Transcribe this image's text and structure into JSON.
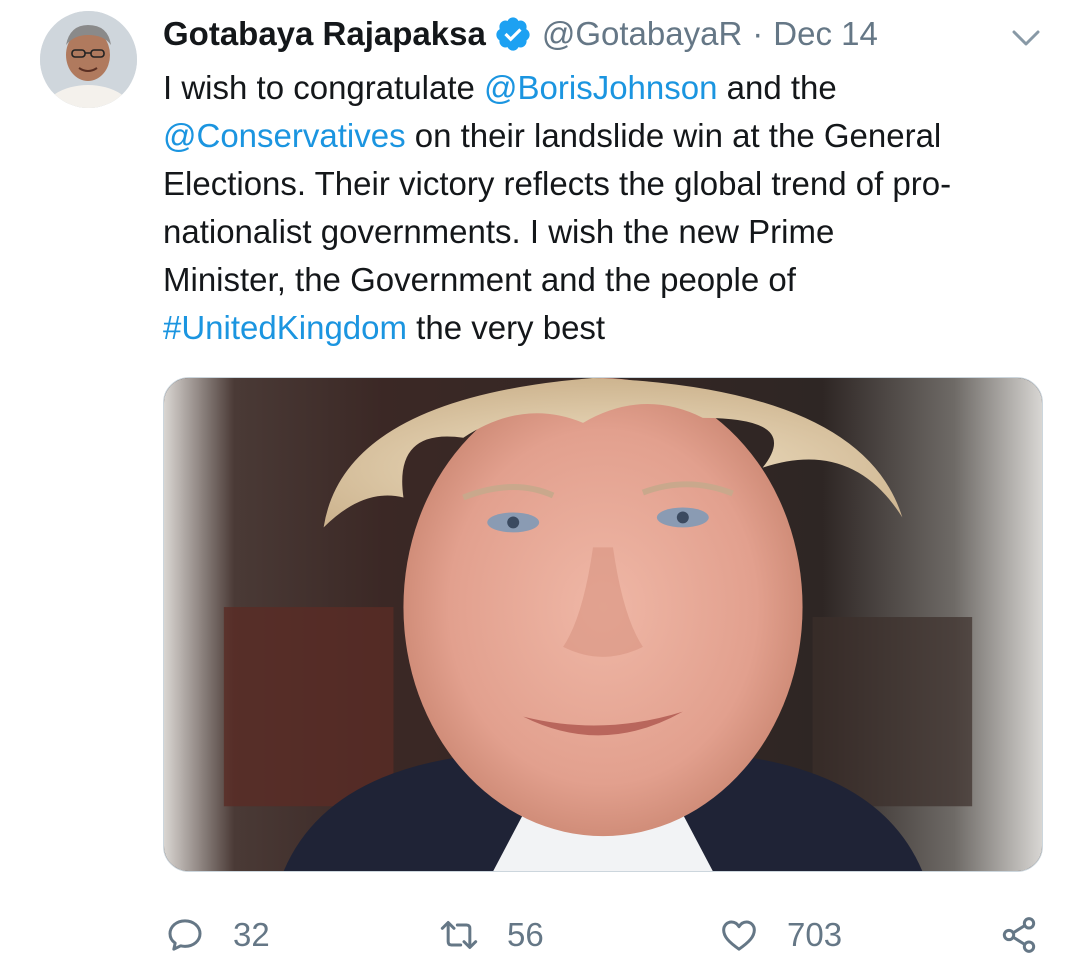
{
  "tweet": {
    "author": {
      "display_name": "Gotabaya Rajapaksa",
      "handle": "@GotabayaR",
      "verified": true
    },
    "separator": "·",
    "date": "Dec 14",
    "text_lines": [
      [
        {
          "t": "I wish to congratulate "
        },
        {
          "t": "@BorisJohnson",
          "link": true
        },
        {
          "t": " and the"
        }
      ],
      [
        {
          "t": "@Conservatives",
          "link": true
        },
        {
          "t": " on their landslide win at the General"
        }
      ],
      [
        {
          "t": "Elections. Their victory reflects the global trend of pro-"
        }
      ],
      [
        {
          "t": "nationalist governments. I wish the new Prime"
        }
      ],
      [
        {
          "t": "Minister, the Government and the people of"
        }
      ],
      [
        {
          "t": "#UnitedKingdom",
          "link": true
        },
        {
          "t": " the very best"
        }
      ]
    ],
    "stats": {
      "replies": "32",
      "retweets": "56",
      "likes": "703"
    }
  },
  "colors": {
    "text": "#14171a",
    "muted": "#657786",
    "link": "#1b95e0",
    "verified": "#1da1f2"
  },
  "icons": {
    "verified": "verified-badge-icon",
    "caret": "chevron-down-icon",
    "reply": "reply-bubble-icon",
    "retweet": "retweet-icon",
    "like": "heart-icon",
    "share": "share-icon"
  }
}
